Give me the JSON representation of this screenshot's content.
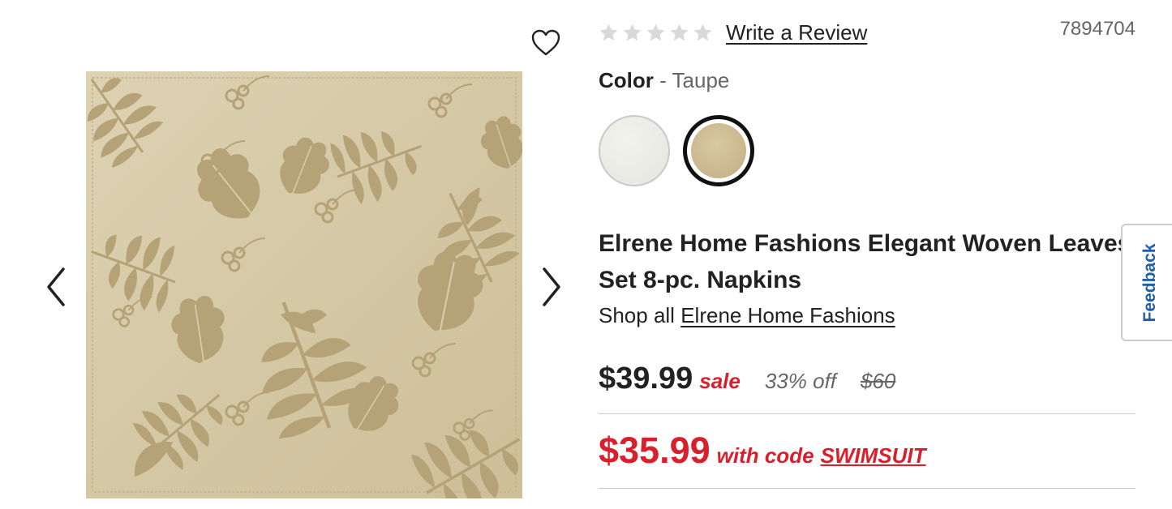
{
  "gallery": {
    "image_icon": "napkin-leaf-pattern-image",
    "prev_icon": "chevron-left-icon",
    "next_icon": "chevron-right-icon",
    "wishlist_icon": "heart-icon"
  },
  "rating": {
    "stars_filled": 0,
    "stars_total": 5,
    "review_link": "Write a Review"
  },
  "sku": "7894704",
  "color": {
    "label": "Color",
    "separator": " - ",
    "value": "Taupe",
    "swatches": [
      {
        "name": "Ivory",
        "selected": false,
        "color": "#e8e9e2"
      },
      {
        "name": "Taupe",
        "selected": true,
        "color": "#cbb68c"
      }
    ]
  },
  "product": {
    "title_line1": "Elrene Home Fashions Elegant Woven Leaves",
    "title_line2": "Set 8-pc. Napkins",
    "shop_all_prefix": "Shop all",
    "brand_link": "Elrene Home Fashions"
  },
  "pricing": {
    "price": "$39.99",
    "sale_label": "sale",
    "percent_off": "33% off",
    "original_price": "$60",
    "code_price": "$35.99",
    "code_text": "with code",
    "promo_code": "SWIMSUIT"
  },
  "feedback_tab": "Feedback",
  "colors": {
    "sale_red": "#d91f2b",
    "feedback_blue": "#1f5ea8",
    "fabric": "#d6cba7",
    "leaf": "#b8a57c"
  }
}
